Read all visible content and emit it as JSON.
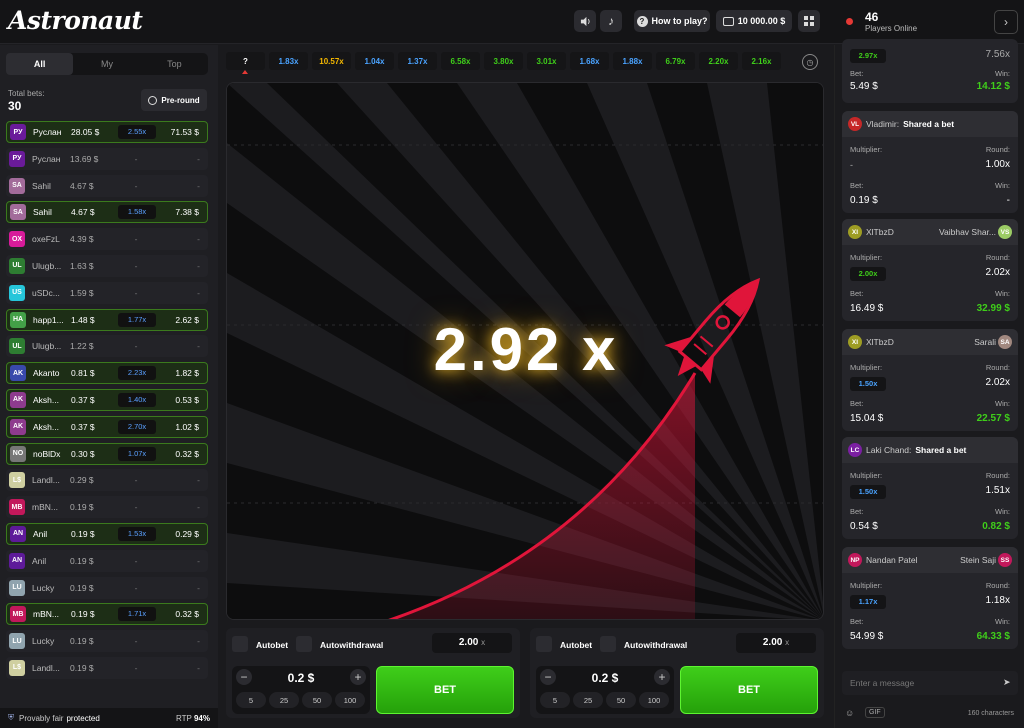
{
  "header": {
    "logo": "Astronaut",
    "how_to_play": "How to play?",
    "balance": "10 000.00 $",
    "online_count": "46",
    "online_label": "Players Online"
  },
  "left": {
    "tabs": [
      "All",
      "My",
      "Top"
    ],
    "total_label": "Total bets:",
    "total_value": "30",
    "preround": "Pre-round",
    "bets": [
      {
        "av": "РУ",
        "color": "#6a1b9a",
        "name": "Руслан",
        "amount": "28.05 $",
        "mul": "2.55x",
        "win": "71.53 $",
        "won": true
      },
      {
        "av": "РУ",
        "color": "#6a1b9a",
        "name": "Руслан",
        "amount": "13.69 $",
        "mul": "-",
        "win": "-",
        "won": false
      },
      {
        "av": "SA",
        "color": "#a26b9a",
        "name": "Sahil",
        "amount": "4.67 $",
        "mul": "-",
        "win": "-",
        "won": false
      },
      {
        "av": "SA",
        "color": "#a26b9a",
        "name": "Sahil",
        "amount": "4.67 $",
        "mul": "1.58x",
        "win": "7.38 $",
        "won": true
      },
      {
        "av": "OX",
        "color": "#d81b9a",
        "name": "oxeFzL",
        "amount": "4.39 $",
        "mul": "-",
        "win": "-",
        "won": false
      },
      {
        "av": "UL",
        "color": "#2e7d32",
        "name": "Ulugb...",
        "amount": "1.63 $",
        "mul": "-",
        "win": "-",
        "won": false
      },
      {
        "av": "US",
        "color": "#26c6da",
        "name": "uSDc...",
        "amount": "1.59 $",
        "mul": "-",
        "win": "-",
        "won": false
      },
      {
        "av": "HA",
        "color": "#43a047",
        "name": "happ1...",
        "amount": "1.48 $",
        "mul": "1.77x",
        "win": "2.62 $",
        "won": true
      },
      {
        "av": "UL",
        "color": "#2e7d32",
        "name": "Ulugb...",
        "amount": "1.22 $",
        "mul": "-",
        "win": "-",
        "won": false
      },
      {
        "av": "AK",
        "color": "#3949ab",
        "name": "Akanto",
        "amount": "0.81 $",
        "mul": "2.23x",
        "win": "1.82 $",
        "won": true
      },
      {
        "av": "AK",
        "color": "#8e3b8e",
        "name": "Aksh...",
        "amount": "0.37 $",
        "mul": "1.40x",
        "win": "0.53 $",
        "won": true
      },
      {
        "av": "AK",
        "color": "#8e3b8e",
        "name": "Aksh...",
        "amount": "0.37 $",
        "mul": "2.70x",
        "win": "1.02 $",
        "won": true
      },
      {
        "av": "NO",
        "color": "#777777",
        "name": "noBlDx",
        "amount": "0.30 $",
        "mul": "1.07x",
        "win": "0.32 $",
        "won": true
      },
      {
        "av": "L$",
        "color": "#cfcfa0",
        "name": "Landl...",
        "amount": "0.29 $",
        "mul": "-",
        "win": "-",
        "won": false
      },
      {
        "av": "MB",
        "color": "#c2185b",
        "name": "mBN...",
        "amount": "0.19 $",
        "mul": "-",
        "win": "-",
        "won": false
      },
      {
        "av": "AN",
        "color": "#5e1a9a",
        "name": "Anil",
        "amount": "0.19 $",
        "mul": "1.53x",
        "win": "0.29 $",
        "won": true
      },
      {
        "av": "AN",
        "color": "#5e1a9a",
        "name": "Anil",
        "amount": "0.19 $",
        "mul": "-",
        "win": "-",
        "won": false
      },
      {
        "av": "LU",
        "color": "#90a4ae",
        "name": "Lucky",
        "amount": "0.19 $",
        "mul": "-",
        "win": "-",
        "won": false
      },
      {
        "av": "MB",
        "color": "#c2185b",
        "name": "mBN...",
        "amount": "0.19 $",
        "mul": "1.71x",
        "win": "0.32 $",
        "won": true
      },
      {
        "av": "LU",
        "color": "#90a4ae",
        "name": "Lucky",
        "amount": "0.19 $",
        "mul": "-",
        "win": "-",
        "won": false
      },
      {
        "av": "L$",
        "color": "#cfcfa0",
        "name": "Landl...",
        "amount": "0.19 $",
        "mul": "-",
        "win": "-",
        "won": false
      }
    ],
    "fair": "Provably fair",
    "fair_status": "protected",
    "rtp_label": "RTP",
    "rtp_value": "94%"
  },
  "history": [
    {
      "v": "?",
      "c": "#ffffff"
    },
    {
      "v": "1.83x",
      "c": "#4aa3ff"
    },
    {
      "v": "10.57x",
      "c": "#f5b800"
    },
    {
      "v": "1.04x",
      "c": "#4aa3ff"
    },
    {
      "v": "1.37x",
      "c": "#4aa3ff"
    },
    {
      "v": "6.58x",
      "c": "#3fce1a"
    },
    {
      "v": "3.80x",
      "c": "#3fce1a"
    },
    {
      "v": "3.01x",
      "c": "#3fce1a"
    },
    {
      "v": "1.68x",
      "c": "#4aa3ff"
    },
    {
      "v": "1.88x",
      "c": "#4aa3ff"
    },
    {
      "v": "6.79x",
      "c": "#3fce1a"
    },
    {
      "v": "2.20x",
      "c": "#3fce1a"
    },
    {
      "v": "2.16x",
      "c": "#3fce1a"
    }
  ],
  "game": {
    "multiplier": "2.92 x",
    "accent": "#e0153a"
  },
  "panels": [
    {
      "autobet": "Autobet",
      "autowithdrawal": "Autowithdrawal",
      "auto_value": "2.00",
      "auto_unit": "x",
      "amount": "0.2 $",
      "quick": [
        "5",
        "25",
        "50",
        "100"
      ],
      "bet": "BET"
    },
    {
      "autobet": "Autobet",
      "autowithdrawal": "Autowithdrawal",
      "auto_value": "2.00",
      "auto_unit": "x",
      "amount": "0.2 $",
      "quick": [
        "5",
        "25",
        "50",
        "100"
      ],
      "bet": "BET"
    }
  ],
  "right": {
    "top": {
      "mul": "2.97x",
      "round": "7.56x",
      "bet_label": "Bet:",
      "bet": "5.49 $",
      "win_label": "Win:",
      "win": "14.12 $"
    },
    "cards": [
      {
        "av": "VL",
        "color": "#c62828",
        "name": "Vladimir:",
        "shared": "Shared a bet",
        "rname": "",
        "rav": "",
        "rcolor": "",
        "mul": "-",
        "round": "1.00x",
        "bet": "0.19 $",
        "win": "-",
        "mulcolor": "#aaaaaa",
        "wincolor": "#ffffff"
      },
      {
        "av": "XI",
        "color": "#9e9d24",
        "name": "XlTbzD",
        "shared": "",
        "rname": "Vaibhav Shar...",
        "rav": "VS",
        "rcolor": "#9ccc65",
        "mul": "2.00x",
        "round": "2.02x",
        "bet": "16.49 $",
        "win": "32.99 $",
        "mulcolor": "#3fce1a",
        "wincolor": "#3fce1a"
      },
      {
        "av": "XI",
        "color": "#9e9d24",
        "name": "XlTbzD",
        "shared": "",
        "rname": "Sarali",
        "rav": "SA",
        "rcolor": "#a1887f",
        "mul": "1.50x",
        "round": "2.02x",
        "bet": "15.04 $",
        "win": "22.57 $",
        "mulcolor": "#4aa3ff",
        "wincolor": "#3fce1a"
      },
      {
        "av": "LC",
        "color": "#7b1fa2",
        "name": "Laki Chand:",
        "shared": "Shared a bet",
        "rname": "",
        "rav": "",
        "rcolor": "",
        "mul": "1.50x",
        "round": "1.51x",
        "bet": "0.54 $",
        "win": "0.82 $",
        "mulcolor": "#4aa3ff",
        "wincolor": "#3fce1a"
      },
      {
        "av": "NP",
        "color": "#c2185b",
        "name": "Nandan Patel",
        "shared": "",
        "rname": "Stein Saji",
        "rav": "SS",
        "rcolor": "#c2185b",
        "mul": "1.17x",
        "round": "1.18x",
        "bet": "54.99 $",
        "win": "64.33 $",
        "mulcolor": "#4aa3ff",
        "wincolor": "#3fce1a"
      }
    ],
    "labels": {
      "multiplier": "Multiplier:",
      "round": "Round:",
      "bet": "Bet:",
      "win": "Win:"
    },
    "chat_placeholder": "Enter a message",
    "gif": "GIF",
    "char_count": "160 characters"
  }
}
